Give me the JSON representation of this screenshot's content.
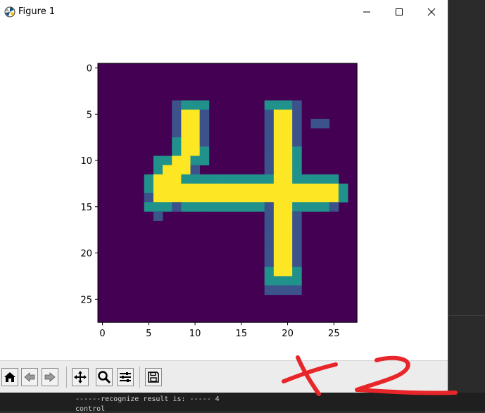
{
  "window": {
    "title": "Figure 1",
    "controls": [
      "minimize",
      "maximize",
      "close"
    ]
  },
  "figure": {
    "type": "imshow",
    "colormap": "viridis",
    "grid_size": 28,
    "x_ticks": [
      "0",
      "5",
      "10",
      "15",
      "20",
      "25"
    ],
    "y_ticks": [
      "0",
      "5",
      "10",
      "15",
      "20",
      "25"
    ],
    "colors": {
      "background": "#440154",
      "low": "#3b528b",
      "mid": "#21918c",
      "high_mid": "#5ec962",
      "high": "#fde725"
    },
    "intensity_rows": [
      "............................",
      "............................",
      "............................",
      "........................... ",
      "........LMMM......MMML......",
      "........LHHL......LHHL......",
      "........LHHL......LHHL.LL...",
      "........LHHL......LHHL......",
      "........MHHL......LHHL......",
      "........MHHM......LHHM......",
      "......MMHHMM......LHHM......",
      "......MHHHL.......LHHM......",
      ".....MHHHMMMMMMMMMMHHMMMMM..",
      ".....MHHHHHHHHHHHHHHHHHHHHM.",
      ".....LHHHHHHHHHHHHHHHHHHHHM.",
      ".....MMMLMMMMMMMMMLHHMMMML..",
      "......L...........LHHL......",
      "..................LHHL......",
      "..................LHHL......",
      "..................LHHL......",
      "..................LHHL......",
      "..................LHHL......",
      "..................MHHM......",
      "..................MMMM......",
      "..................LLLL......",
      "............................",
      "............................",
      "............................"
    ]
  },
  "toolbar": {
    "buttons": [
      {
        "name": "home-icon",
        "glyph": "⌂"
      },
      {
        "name": "back-icon",
        "glyph": "⇦"
      },
      {
        "name": "forward-icon",
        "glyph": "⇨"
      },
      {
        "name": "pan-icon",
        "glyph": "✥"
      },
      {
        "name": "zoom-icon",
        "glyph": "🔍"
      },
      {
        "name": "configure-subplots-icon",
        "glyph": "☰"
      },
      {
        "name": "save-icon",
        "glyph": "💾"
      }
    ]
  },
  "terminal": {
    "line1": "------recognize result is: ----- 4",
    "line2": "control"
  },
  "annotation": {
    "text": "+2",
    "color": "#e8262a"
  }
}
